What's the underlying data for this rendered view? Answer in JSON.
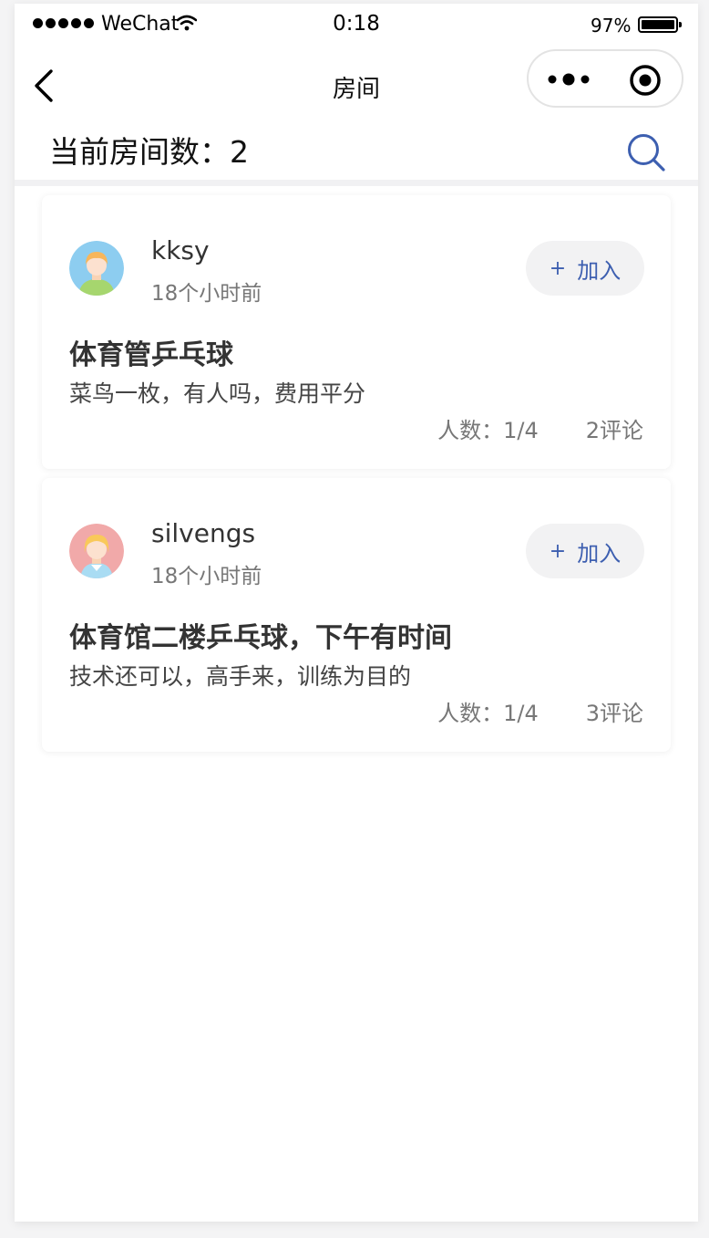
{
  "status_bar": {
    "carrier": "WeChat",
    "time": "0:18",
    "battery": "97%"
  },
  "nav": {
    "title": "房间"
  },
  "header": {
    "room_count": "当前房间数：2"
  },
  "rooms": [
    {
      "username": "kksy",
      "time_ago": "18个小时前",
      "join_label": "加入",
      "title": "体育管乒乓球",
      "description": "菜鸟一枚，有人吗，费用平分",
      "people": "人数：1/4",
      "comments": "2评论"
    },
    {
      "username": "silvengs",
      "time_ago": "18个小时前",
      "join_label": "加入",
      "title": "体育馆二楼乒乓球，下午有时间",
      "description": "技术还可以，高手来，训练为目的",
      "people": "人数：1/4",
      "comments": "3评论"
    }
  ],
  "colors": {
    "accent": "#3d5fb0",
    "background": "#ffffff",
    "join_button_bg": "#f2f2f3"
  },
  "icons": {
    "back": "chevron-left-icon",
    "more": "more-dots-icon",
    "close_target": "target-icon",
    "search": "search-icon",
    "avatar_1": "avatar-boy-icon",
    "avatar_2": "avatar-girl-icon"
  }
}
